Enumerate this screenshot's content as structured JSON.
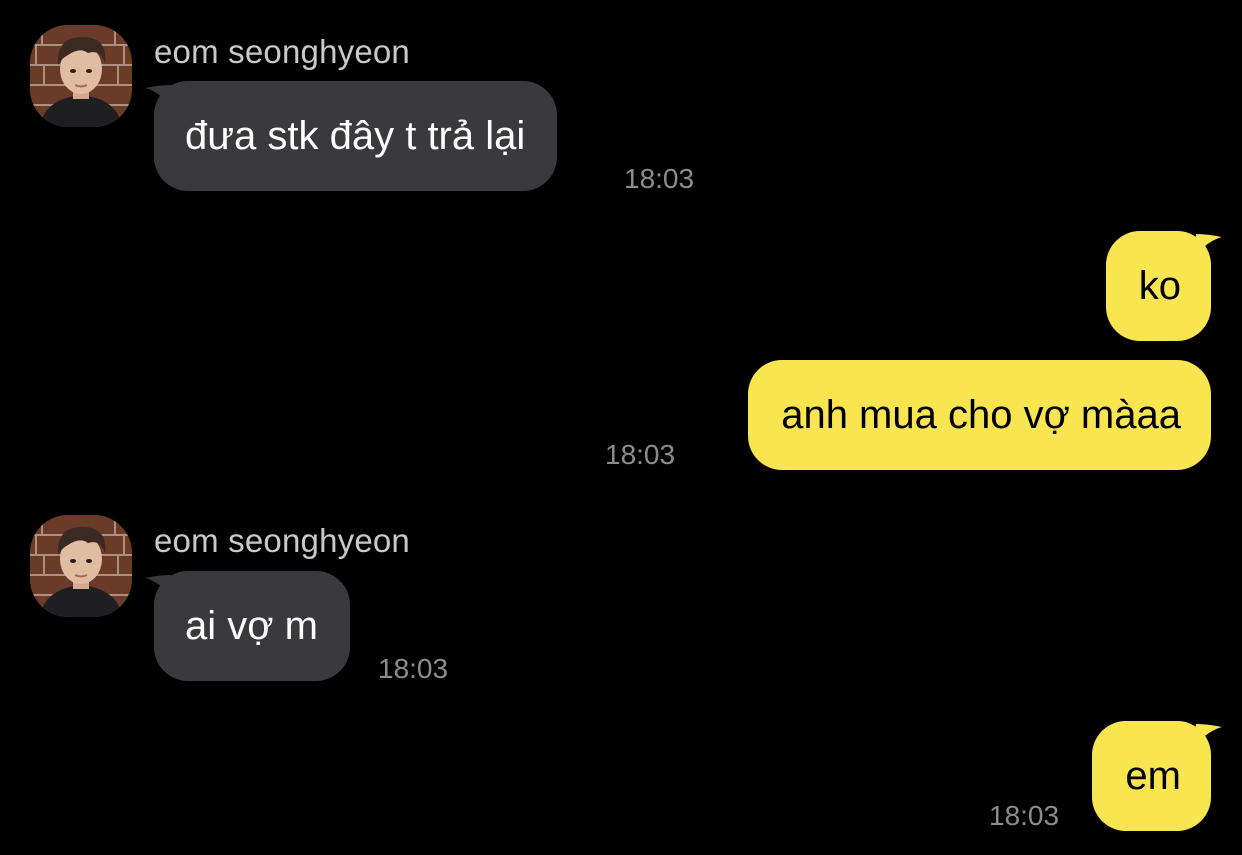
{
  "theme": {
    "background": "#000000",
    "incoming_bubble": "#3a3a3c",
    "outgoing_bubble": "#f9e550",
    "sender_name_color": "#c9c9c9",
    "timestamp_color": "#8c8c8c"
  },
  "messages": [
    {
      "direction": "incoming",
      "sender": "eom seonghyeon",
      "avatar_icon": "profile-photo",
      "text": "đưa stk đây t trả lại",
      "time": "18:03"
    },
    {
      "direction": "outgoing",
      "text": "ko",
      "time": ""
    },
    {
      "direction": "outgoing",
      "text": "anh mua cho vợ màaa",
      "time": "18:03"
    },
    {
      "direction": "incoming",
      "sender": "eom seonghyeon",
      "avatar_icon": "profile-photo",
      "text": "ai vợ m",
      "time": "18:03"
    },
    {
      "direction": "outgoing",
      "text": "em",
      "time": "18:03"
    }
  ]
}
